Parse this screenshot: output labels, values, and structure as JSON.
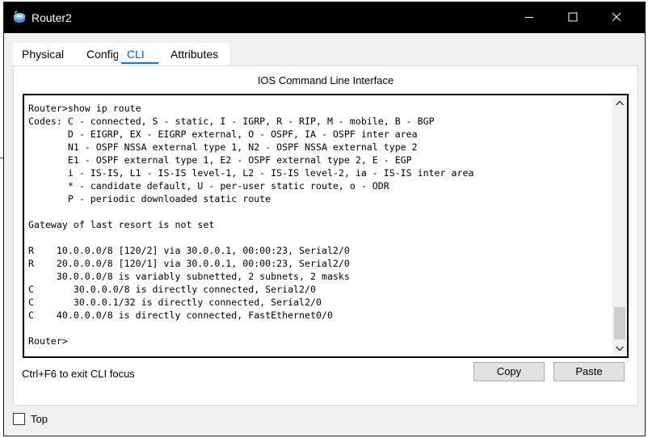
{
  "window": {
    "title": "Router2"
  },
  "icons": {
    "app": "router-icon",
    "minimize": "minimize-icon",
    "maximize": "maximize-icon",
    "close": "close-icon",
    "scroll_up": "chevron-up-icon",
    "scroll_down": "chevron-down-icon"
  },
  "tabs": [
    {
      "label": "Physical"
    },
    {
      "label": "Config"
    },
    {
      "label": "CLI"
    },
    {
      "label": "Attributes"
    }
  ],
  "active_tab": "CLI",
  "cli": {
    "heading": "IOS Command Line Interface",
    "lines": [
      "Router>show ip route",
      "Codes: C - connected, S - static, I - IGRP, R - RIP, M - mobile, B - BGP",
      "       D - EIGRP, EX - EIGRP external, O - OSPF, IA - OSPF inter area",
      "       N1 - OSPF NSSA external type 1, N2 - OSPF NSSA external type 2",
      "       E1 - OSPF external type 1, E2 - OSPF external type 2, E - EGP",
      "       i - IS-IS, L1 - IS-IS level-1, L2 - IS-IS level-2, ia - IS-IS inter area",
      "       * - candidate default, U - per-user static route, o - ODR",
      "       P - periodic downloaded static route",
      "",
      "Gateway of last resort is not set",
      "",
      "R    10.0.0.0/8 [120/2] via 30.0.0.1, 00:00:23, Serial2/0",
      "R    20.0.0.0/8 [120/1] via 30.0.0.1, 00:00:23, Serial2/0",
      "     30.0.0.0/8 is variably subnetted, 2 subnets, 2 masks",
      "C       30.0.0.0/8 is directly connected, Serial2/0",
      "C       30.0.0.1/32 is directly connected, Serial2/0",
      "C    40.0.0.0/8 is directly connected, FastEthernet0/0",
      "",
      "Router>"
    ]
  },
  "footer": {
    "hint": "Ctrl+F6 to exit CLI focus",
    "copy_label": "Copy",
    "paste_label": "Paste"
  },
  "top_checkbox": {
    "label": "Top",
    "checked": false
  },
  "colors": {
    "titlebar": "#000000",
    "accent": "#0a64c8",
    "window_bg": "#f0f0f0",
    "button_bg": "#e1e1e1"
  }
}
